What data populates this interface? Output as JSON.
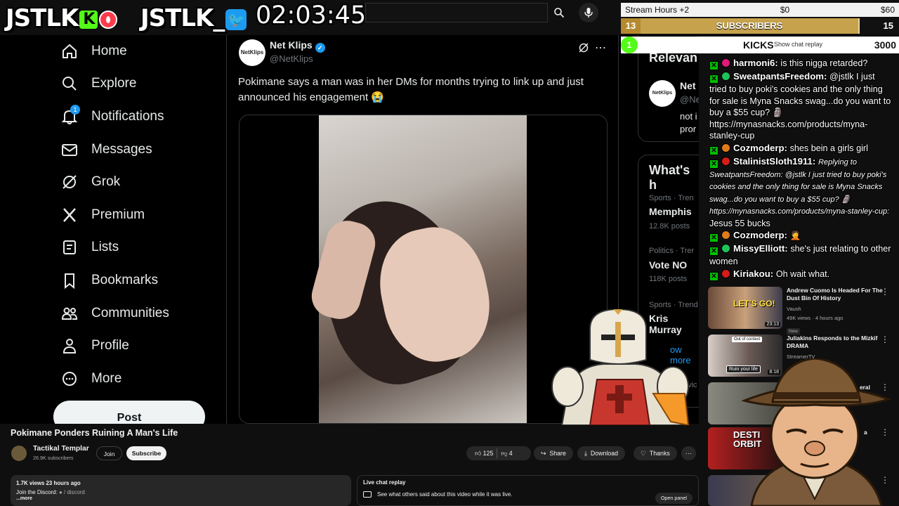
{
  "overlay": {
    "logo1": "JSTLK",
    "logo1_kick_letter": "K",
    "logo2": "JSTLK_",
    "timer": "02:03:45"
  },
  "stream_goals": {
    "label": "Stream Hours +2",
    "start_amount": "$0",
    "end_amount": "$60",
    "subs_left": "13",
    "subs_label": "SUBSCRIBERS",
    "subs_right": "15",
    "kicks_badge": "1",
    "kicks_label": "KICKS",
    "kicks_note": "Show chat replay",
    "kicks_value": "3000"
  },
  "twitter": {
    "nav": [
      {
        "label": "Home",
        "icon": "home-icon"
      },
      {
        "label": "Explore",
        "icon": "search-icon"
      },
      {
        "label": "Notifications",
        "icon": "bell-icon"
      },
      {
        "label": "Messages",
        "icon": "envelope-icon"
      },
      {
        "label": "Grok",
        "icon": "grok-icon"
      },
      {
        "label": "Premium",
        "icon": "x-logo-icon"
      },
      {
        "label": "Lists",
        "icon": "list-icon"
      },
      {
        "label": "Bookmarks",
        "icon": "bookmark-icon"
      },
      {
        "label": "Communities",
        "icon": "people-icon"
      },
      {
        "label": "Profile",
        "icon": "person-icon"
      },
      {
        "label": "More",
        "icon": "more-circle-icon"
      }
    ],
    "notif_count": "1",
    "post_label": "Post",
    "tweet": {
      "avatar_text": "NetKlips",
      "author": "Net Klips",
      "handle": "@NetKlips",
      "text": "Pokimane says a man was in her DMs for months trying to link up and just announced his engagement 😭"
    },
    "right": {
      "relevant_title": "Relevan",
      "relevant_name": "Net",
      "relevant_handle": "@Ne",
      "relevant_bio1": "not i",
      "relevant_bio2": "pror",
      "whats_title": "What's h",
      "trends": [
        {
          "meta": "Sports · Tren",
          "name": "Memphis",
          "count": "12.8K posts"
        },
        {
          "meta": "Politics · Trer",
          "name": "Vote NO",
          "count": "118K posts"
        },
        {
          "meta": "Sports · Trend",
          "name": "Kris Murray",
          "count": ""
        }
      ],
      "show_more": "ow more",
      "terms": "Servic"
    }
  },
  "chat": [
    {
      "user": "harmoni6",
      "color": "#ffffff",
      "dot": "#e0197a",
      "text": "is this nigga retarded?"
    },
    {
      "user": "SweatpantsFreedom",
      "color": "#ffffff",
      "dot": "#1ec45a",
      "text": "@jstlk I just tried to buy poki's cookies and the only thing for sale is Myna Snacks swag...do you want to buy a $55 cup? 🗿 https://mynasnacks.com/products/myna-stanley-cup"
    },
    {
      "user": "Cozmoderp",
      "color": "#ffffff",
      "dot": "#e07b1a",
      "text": "shes bein a girls girl"
    },
    {
      "user": "StalinistSloth1911",
      "color": "#ffffff",
      "dot": "#d61b1b",
      "reply": "Replying to SweatpantsFreedom: @jstlk I just tried to buy poki's cookies and the only thing for sale is Myna Snacks swag...do you want to buy a $55 cup? 🗿 https://mynasnacks.com/products/myna-stanley-cup:",
      "text": "Jesus 55 bucks"
    },
    {
      "user": "Cozmoderp",
      "color": "#ffffff",
      "dot": "#e07b1a",
      "text": "🤦"
    },
    {
      "user": "MissyElliott",
      "color": "#ffffff",
      "dot": "#1ec45a",
      "text": "she's just relating to other women"
    },
    {
      "user": "Kiriakou",
      "color": "#ffffff",
      "dot": "#d61b1b",
      "text": "Oh wait what."
    }
  ],
  "sidebar_videos": [
    {
      "title": "Andrew Cuomo Is Headed For The Dust Bin Of History",
      "channel": "Vaush",
      "meta": "49K views · 4 hours ago",
      "badge": "New",
      "thumb_text": "LET'S GO!",
      "duration": "23:13"
    },
    {
      "title": "Juliakins Responds to the Mizkif DRAMA",
      "channel": "StreamerTV",
      "meta": "",
      "badge": "",
      "thumb_text": "Out of context",
      "thumb_text2": "Ruin your life",
      "duration": "8:18"
    },
    {
      "title": "eral",
      "channel": "",
      "meta": "",
      "badge": "",
      "thumb_text": "",
      "duration": ""
    },
    {
      "title": "a",
      "channel": "",
      "meta": "",
      "badge": "",
      "thumb_text": "DESTI ORBIT",
      "duration": ""
    },
    {
      "title": "",
      "channel": "",
      "meta": "",
      "badge": "",
      "thumb_text": "",
      "duration": ""
    }
  ],
  "video": {
    "title": "Pokimane Ponders Ruining A Man's Life",
    "channel": "Tactikal Templar",
    "subs": "26.9K subscribers",
    "join": "Join",
    "subscribe": "Subscribe",
    "likes": "125",
    "dislikes": "4",
    "share": "Share",
    "download": "Download",
    "thanks": "Thanks",
    "desc_stats": "1.7K views  23 hours ago",
    "desc_line": "Join the Discord:",
    "desc_link": "/ discord",
    "desc_more": "...more",
    "livechat_title": "Live chat replay",
    "livechat_text": "See what others said about this video while it was live.",
    "open_panel": "Open panel"
  }
}
